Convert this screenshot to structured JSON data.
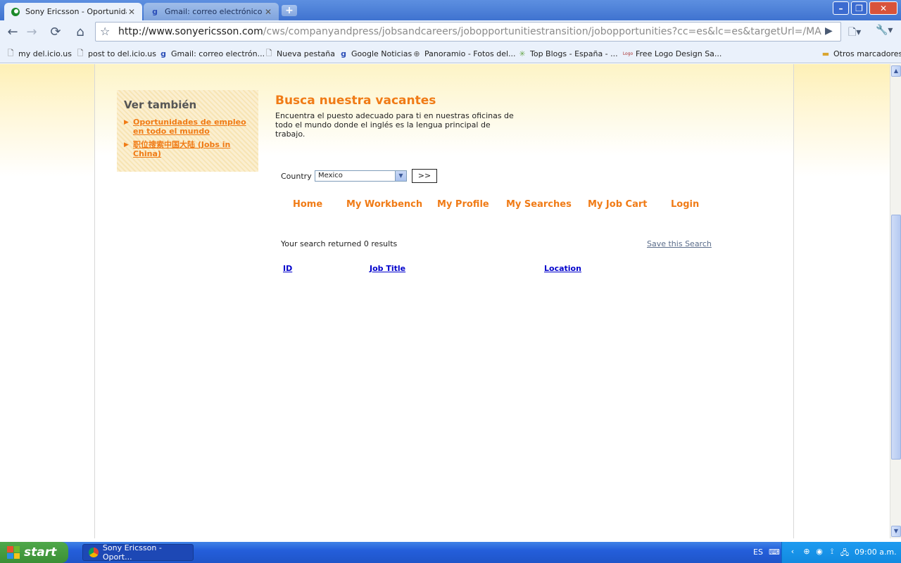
{
  "browser": {
    "tabs": [
      {
        "title": "Sony Ericsson - Oportunida...",
        "close": "✕",
        "icon": "sony-ericsson-favicon"
      },
      {
        "title": "Gmail: correo electrónico d...",
        "close": "✕",
        "icon": "google-favicon"
      }
    ],
    "new_tab": "+",
    "url_host": "http://www.sonyericsson.com",
    "url_path": "/cws/companyandpress/jobsandcareers/jobopportunitiestransition/jobopportunities?cc=es&lc=es&targetUrl=/MAIN/careerportal/defa",
    "bookmarks": [
      {
        "label": "my del.icio.us",
        "icon": "page-icon"
      },
      {
        "label": "post to del.icio.us",
        "icon": "page-icon"
      },
      {
        "label": "Gmail: correo electrón...",
        "icon": "google-icon"
      },
      {
        "label": "Nueva pestaña",
        "icon": "page-icon"
      },
      {
        "label": "Google Noticias",
        "icon": "google-icon"
      },
      {
        "label": "Panoramio - Fotos del...",
        "icon": "panoramio-icon"
      },
      {
        "label": "Top Blogs - España - ...",
        "icon": "topblogs-icon"
      },
      {
        "label": "Free Logo Design Sa...",
        "icon": "logo-icon"
      }
    ],
    "other_bookmarks": "Otros marcadores"
  },
  "sidebar": {
    "title": "Ver también",
    "links": [
      {
        "line1": "Oportunidades de empleo",
        "line2": "en todo el mundo"
      },
      {
        "line1": "职位搜索中国大陆 (Jobs in",
        "line2": "China)"
      }
    ]
  },
  "main": {
    "heading": "Busca nuestra vacantes",
    "intro": "Encuentra el puesto adecuado para ti en nuestras oficinas de todo el mundo donde el inglés es la lengua principal de trabajo.",
    "country_label": "Country",
    "country_value": "Mexico",
    "go_label": ">>",
    "menu": [
      "Home",
      "My Workbench",
      "My Profile",
      "My Searches",
      "My Job Cart",
      "Login"
    ],
    "results_text": "Your search returned 0 results",
    "save_search": "Save this Search",
    "columns": [
      "ID",
      "Job Title",
      "Location"
    ]
  },
  "taskbar": {
    "start": "start",
    "task": "Sony Ericsson - Oport...",
    "lang": "ES",
    "clock": "09:00 a.m."
  }
}
